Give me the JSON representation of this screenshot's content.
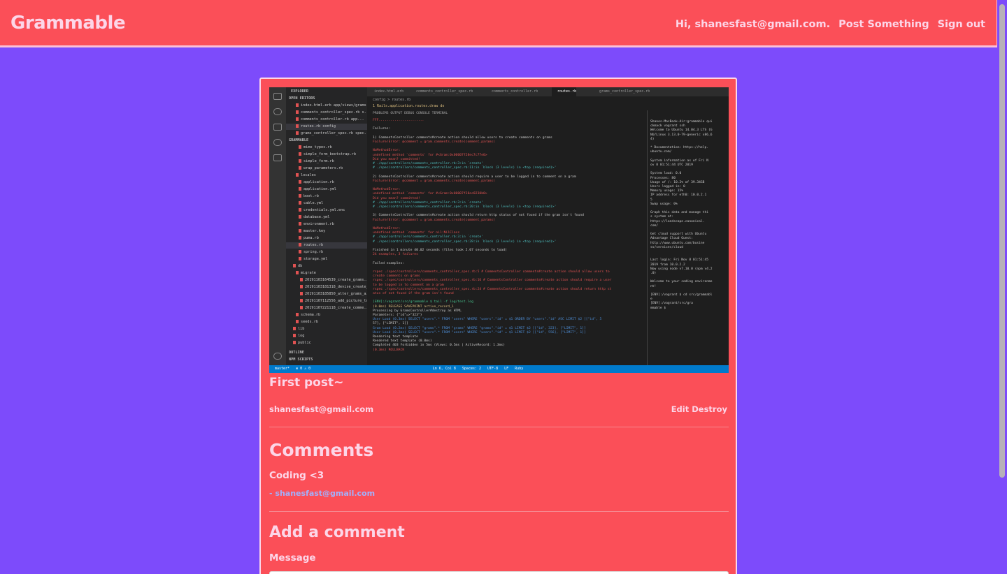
{
  "nav": {
    "brand": "Grammable",
    "greeting": "Hi, shanesfast@gmail.com.",
    "post_link": "Post Something",
    "signout_link": "Sign out"
  },
  "post": {
    "image_alt": "VS Code screenshot showing routes.rb and failing RSpec tests",
    "title": "First post~",
    "author": "shanesfast@gmail.com",
    "edit_label": "Edit",
    "destroy_label": "Destroy"
  },
  "comments": {
    "heading": "Comments",
    "items": [
      {
        "message": "Coding <3",
        "author": "- shanesfast@gmail.com"
      }
    ]
  },
  "add_comment": {
    "heading": "Add a comment",
    "message_label": "Message",
    "message_value": ""
  },
  "colors": {
    "background": "#7d4bfb",
    "navbar": "#fb4f58",
    "text_light": "#fcd6e8",
    "author_link": "#a2b0fc"
  },
  "screenshot": {
    "sidebar": {
      "explorer": "EXPLORER",
      "open_editors": "OPEN EDITORS",
      "project": "GRAMMABLE",
      "outline": "OUTLINE",
      "npm": "NPM SCRIPTS",
      "files": [
        "index.html.erb app/views/grams",
        "comments_controller_spec.rb s...",
        "comments_controller.rb app...",
        "routes.rb config",
        "grams_controller_spec.rb spec...",
        "mime_types.rb",
        "simple_form_bootstrap.rb",
        "simple_form.rb",
        "wrap_parameters.rb",
        "locales",
        "application.rb",
        "application.yml",
        "boot.rb",
        "cable.yml",
        "credentials.yml.enc",
        "database.yml",
        "environment.rb",
        "master.key",
        "puma.rb",
        "routes.rb",
        "spring.rb",
        "storage.yml",
        "db",
        "migrate",
        "20191103164539_create_grams...",
        "20191103181318_devise_create_...",
        "20191103185850_alter_grams_a...",
        "20191107112556_add_picture_to...",
        "20191107221118_create_comme...",
        "schema.rb",
        "seeds.rb",
        "lib",
        "log",
        "public"
      ]
    },
    "tabs": [
      "index.html.erb",
      "comments_controller_spec.rb",
      "comments_controller.rb",
      "routes.rb",
      "grams_controller_spec.rb"
    ],
    "breadcrumb": "config > routes.rb",
    "code_line": "1    Rails.application.routes.draw do",
    "panel_tabs": "PROBLEMS   OUTPUT   DEBUG CONSOLE   TERMINAL",
    "terminal": [
      {
        "t": "FFF.......................",
        "c": "c-r"
      },
      {
        "t": "",
        "c": "c-w"
      },
      {
        "t": "Failures:",
        "c": "c-w"
      },
      {
        "t": "",
        "c": "c-w"
      },
      {
        "t": "  1) CommentsController comments#create action should allow users to create comments on grams",
        "c": "c-w"
      },
      {
        "t": "     Failure/Error: @comment = gram.comments.create(comment_params)",
        "c": "c-r"
      },
      {
        "t": "",
        "c": "c-w"
      },
      {
        "t": "     NoMethodError:",
        "c": "c-r"
      },
      {
        "t": "       undefined method `comments' for #<Gram:0x00007f28ec7c77e0>",
        "c": "c-r"
      },
      {
        "t": "       Did you mean?  committed!",
        "c": "c-r"
      },
      {
        "t": "     # ./app/controllers/comments_controller.rb:3:in `create'",
        "c": "c-c"
      },
      {
        "t": "     # ./spec/controllers/comments_controller_spec.rb:11:in `block (3 levels) in <top (required)>'",
        "c": "c-c"
      },
      {
        "t": "",
        "c": "c-w"
      },
      {
        "t": "  2) CommentsController comments#create action should require a user to be logged in to comment on a gram",
        "c": "c-w"
      },
      {
        "t": "     Failure/Error: @comment = gram.comments.create(comment_params)",
        "c": "c-r"
      },
      {
        "t": "",
        "c": "c-w"
      },
      {
        "t": "     NoMethodError:",
        "c": "c-r"
      },
      {
        "t": "       undefined method `comments' for #<Gram:0x00007f28ec8230b0>",
        "c": "c-r"
      },
      {
        "t": "       Did you mean?  committed!",
        "c": "c-r"
      },
      {
        "t": "     # ./app/controllers/comments_controller.rb:3:in `create'",
        "c": "c-c"
      },
      {
        "t": "     # ./spec/controllers/comments_controller_spec.rb:20:in `block (3 levels) in <top (required)>'",
        "c": "c-c"
      },
      {
        "t": "",
        "c": "c-w"
      },
      {
        "t": "  3) CommentsController comments#create action should return http status of not found if the gram isn't found",
        "c": "c-w"
      },
      {
        "t": "     Failure/Error: @comment = gram.comments.create(comment_params)",
        "c": "c-r"
      },
      {
        "t": "",
        "c": "c-w"
      },
      {
        "t": "     NoMethodError:",
        "c": "c-r"
      },
      {
        "t": "       undefined method `comments' for nil:NilClass",
        "c": "c-r"
      },
      {
        "t": "     # ./app/controllers/comments_controller.rb:3:in `create'",
        "c": "c-c"
      },
      {
        "t": "     # ./spec/controllers/comments_controller_spec.rb:28:in `block (3 levels) in <top (required)>'",
        "c": "c-c"
      },
      {
        "t": "",
        "c": "c-w"
      },
      {
        "t": "Finished in 1 minute 40.02 seconds (files took 2.07 seconds to load)",
        "c": "c-w"
      },
      {
        "t": "24 examples, 3 failures",
        "c": "c-r"
      },
      {
        "t": "",
        "c": "c-w"
      },
      {
        "t": "Failed examples:",
        "c": "c-w"
      },
      {
        "t": "",
        "c": "c-w"
      },
      {
        "t": "rspec ./spec/controllers/comments_controller_spec.rb:5 # CommentsController comments#create action should allow users to",
        "c": "c-r"
      },
      {
        "t": "create comments on grams",
        "c": "c-r"
      },
      {
        "t": "rspec ./spec/controllers/comments_controller_spec.rb:16 # CommentsController comments#create action should require a user",
        "c": "c-r"
      },
      {
        "t": " to be logged in to comment on a gram",
        "c": "c-r"
      },
      {
        "t": "rspec ./spec/controllers/comments_controller_spec.rb:24 # CommentsController comments#create action should return http st",
        "c": "c-r"
      },
      {
        "t": "atus of not found if the gram isn't found",
        "c": "c-r"
      },
      {
        "t": "",
        "c": "c-w"
      },
      {
        "t": "[ENV]:/vagrant/src/grammable $ tail -f log/test.log",
        "c": "c-g"
      },
      {
        "t": "   (0.0ms)  RELEASE SAVEPOINT active_record_1",
        "c": "c-y"
      },
      {
        "t": "Processing by GramsController#destroy as HTML",
        "c": "c-w"
      },
      {
        "t": "  Parameters: {\"id\"=>\"323\"}",
        "c": "c-w"
      },
      {
        "t": "  User Load (0.3ms)  SELECT  \"users\".* FROM \"users\" WHERE \"users\".\"id\" = $1 ORDER BY \"users\".\"id\" ASC LIMIT $2  [[\"id\", 5",
        "c": "c-b"
      },
      {
        "t": "57], [\"LIMIT\", 1]]",
        "c": "c-w"
      },
      {
        "t": "  Gram Load (0.2ms)  SELECT  \"grams\".* FROM \"grams\" WHERE \"grams\".\"id\" = $1 LIMIT $2  [[\"id\", 323], [\"LIMIT\", 1]]",
        "c": "c-b"
      },
      {
        "t": "  User Load (0.2ms)  SELECT  \"users\".* FROM \"users\" WHERE \"users\".\"id\" = $1 LIMIT $2  [[\"id\", 556], [\"LIMIT\", 1]]",
        "c": "c-b"
      },
      {
        "t": "  Rendering text template",
        "c": "c-w"
      },
      {
        "t": "  Rendered text template (0.0ms)",
        "c": "c-w"
      },
      {
        "t": "Completed 403 Forbidden in 5ms (Views: 0.5ms | ActiveRecord: 1.3ms)",
        "c": "c-w"
      },
      {
        "t": "   (0.3ms)  ROLLBACK",
        "c": "c-r"
      }
    ],
    "terminal2": [
      "Shanes-MacBook-Air:grammable qui",
      "ckmack vagrant ssh",
      "Welcome to Ubuntu 14.04.3 LTS (G",
      "NU/Linux 3.13.0-79-generic x86_6",
      "4)",
      "",
      " * Documentation:  https://help.",
      "ubuntu.com/",
      "",
      "  System information as of Fri N",
      "ov  8 01:51:44 UTC 2019",
      "",
      "  System load:  0.0",
      "    Processes:        80",
      "    Usage of /:   10.2% of 39.34GB",
      "    Users logged in:     0",
      "    Memory usage: 15%",
      "    IP address for eth0: 10.0.2.1",
      "5",
      "    Swap usage:   0%",
      "",
      "  Graph this data and manage thi",
      "s system at:",
      "    https://landscape.canonical.",
      "com/",
      "",
      "  Get cloud support with Ubuntu",
      "Advantage Cloud Guest:",
      "    http://www.ubuntu.com/busine",
      "ss/services/cloud",
      "",
      "",
      "Last login: Fri Nov  8 01:51:45",
      " 2019 from 10.0.2.2",
      "Now using node v7.10.0 (npm v4.2",
      ".0)",
      "",
      "Welcome to your coding environme",
      "nt!",
      "",
      "[ENV]:/vagrant $ cd src/grammabl",
      "e",
      "[ENV]:/vagrant/src/gra",
      "mmable $ "
    ],
    "status": "master*   ⊗ 0 ⚠ 0                                                          Ln 6, Col 8   Spaces: 2   UTF-8   LF   Ruby"
  }
}
